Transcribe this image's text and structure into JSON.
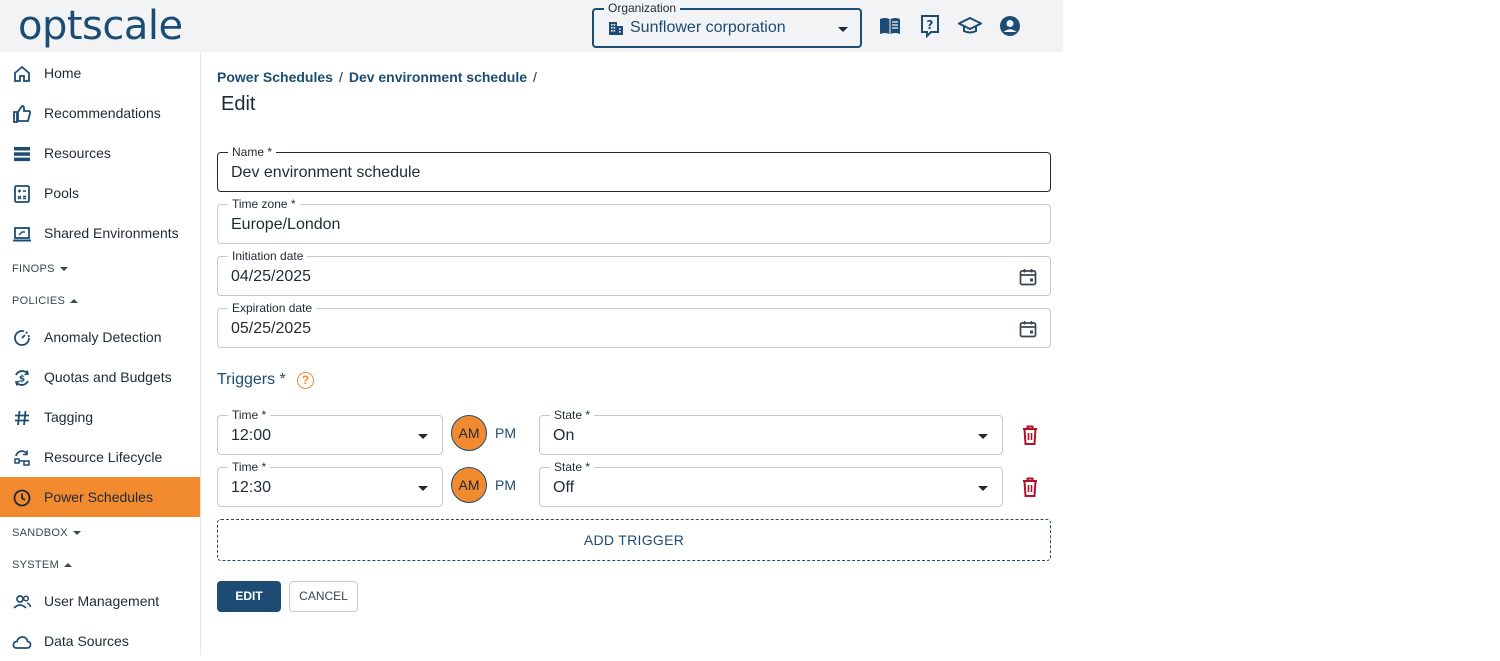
{
  "app": {
    "logo_text": "optscale"
  },
  "header": {
    "organization_label": "Organization",
    "organization_value": "Sunflower corporation",
    "icons": [
      "book-icon",
      "help-document-icon",
      "graduation-cap-icon",
      "account-circle-icon"
    ]
  },
  "sidebar": {
    "items": [
      {
        "label": "Home",
        "icon": "home-icon"
      },
      {
        "label": "Recommendations",
        "icon": "thumbs-up-icon"
      },
      {
        "label": "Resources",
        "icon": "list-icon"
      },
      {
        "label": "Pools",
        "icon": "calculator-icon"
      },
      {
        "label": "Shared Environments",
        "icon": "laptop-icon"
      },
      {
        "label": "Anomaly Detection",
        "icon": "anomaly-icon"
      },
      {
        "label": "Quotas and Budgets",
        "icon": "money-cycle-icon"
      },
      {
        "label": "Tagging",
        "icon": "hash-icon"
      },
      {
        "label": "Resource Lifecycle",
        "icon": "lifecycle-icon"
      },
      {
        "label": "Power Schedules",
        "icon": "clock-icon"
      },
      {
        "label": "User Management",
        "icon": "users-icon"
      },
      {
        "label": "Data Sources",
        "icon": "cloud-icon"
      }
    ],
    "sections": {
      "finops": "FINOPS",
      "policies": "POLICIES",
      "sandbox": "SANDBOX",
      "system": "SYSTEM"
    },
    "active": "Power Schedules"
  },
  "breadcrumb": {
    "items": [
      "Power Schedules",
      "Dev environment schedule"
    ],
    "separator": "/"
  },
  "page": {
    "title": "Edit"
  },
  "form": {
    "name": {
      "label": "Name *",
      "value": "Dev environment schedule"
    },
    "timezone": {
      "label": "Time zone *",
      "value": "Europe/London"
    },
    "initiation_date": {
      "label": "Initiation date",
      "value": "04/25/2025"
    },
    "expiration_date": {
      "label": "Expiration date",
      "value": "05/25/2025"
    },
    "triggers_title": "Triggers *",
    "help_glyph": "?",
    "triggers": [
      {
        "time_label": "Time *",
        "time": "12:00",
        "am": "AM",
        "pm": "PM",
        "state_label": "State *",
        "state": "On"
      },
      {
        "time_label": "Time *",
        "time": "12:30",
        "am": "AM",
        "pm": "PM",
        "state_label": "State *",
        "state": "Off"
      }
    ],
    "add_trigger_label": "ADD TRIGGER",
    "edit_label": "EDIT",
    "cancel_label": "CANCEL"
  },
  "colors": {
    "brand": "#1c4c73",
    "accent": "#f28a30",
    "danger": "#b0112a"
  }
}
